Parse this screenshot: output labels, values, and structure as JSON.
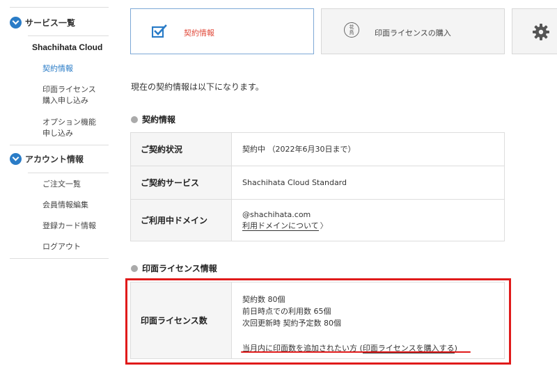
{
  "sidebar": {
    "sections": [
      {
        "label": "サービス一覧",
        "brand": "Shachihata Cloud",
        "items": [
          {
            "label": "契約情報",
            "active": true
          },
          {
            "label": "印面ライセンス\n購入申し込み",
            "line1": "印面ライセンス",
            "line2": "購入申し込み"
          },
          {
            "label": "オプション機能\n申し込み",
            "line1": "オプション機能",
            "line2": "申し込み"
          }
        ]
      },
      {
        "label": "アカウント情報",
        "items": [
          {
            "label": "ご注文一覧"
          },
          {
            "label": "会員情報編集"
          },
          {
            "label": "登録カード情報"
          },
          {
            "label": "ログアウト"
          }
        ]
      }
    ]
  },
  "cards": [
    {
      "label": "契約情報",
      "icon": "checkbox-icon",
      "active": true
    },
    {
      "label": "印面ライセンスの購入",
      "icon": "stamp-icon",
      "stamp_text": "花\n鳥"
    },
    {
      "label": "",
      "icon": "gear-icon"
    }
  ],
  "intro": "現在の契約情報は以下になります。",
  "contract": {
    "heading": "契約情報",
    "rows": [
      {
        "label": "ご契約状況",
        "value": "契約中 （2022年6月30日まで）"
      },
      {
        "label": "ご契約サービス",
        "value": "Shachihata Cloud Standard"
      },
      {
        "label": "ご利用中ドメイン",
        "value": "@shachihata.com",
        "link": "利用ドメインについて",
        "arrow": "〉"
      }
    ]
  },
  "license": {
    "heading": "印面ライセンス情報",
    "label": "印面ライセンス数",
    "lines": [
      "契約数 80個",
      "前日時点での利用数 65個",
      "次回更新時 契約予定数 80個"
    ],
    "purchase_prefix": "当月内に印面数を追加されたい方 (",
    "purchase_link": "印面ライセンスを購入する",
    "purchase_suffix": ")"
  },
  "colors": {
    "accent": "#2a7cc7",
    "active_card_text": "#e0493a",
    "highlight": "#e01a1a"
  }
}
